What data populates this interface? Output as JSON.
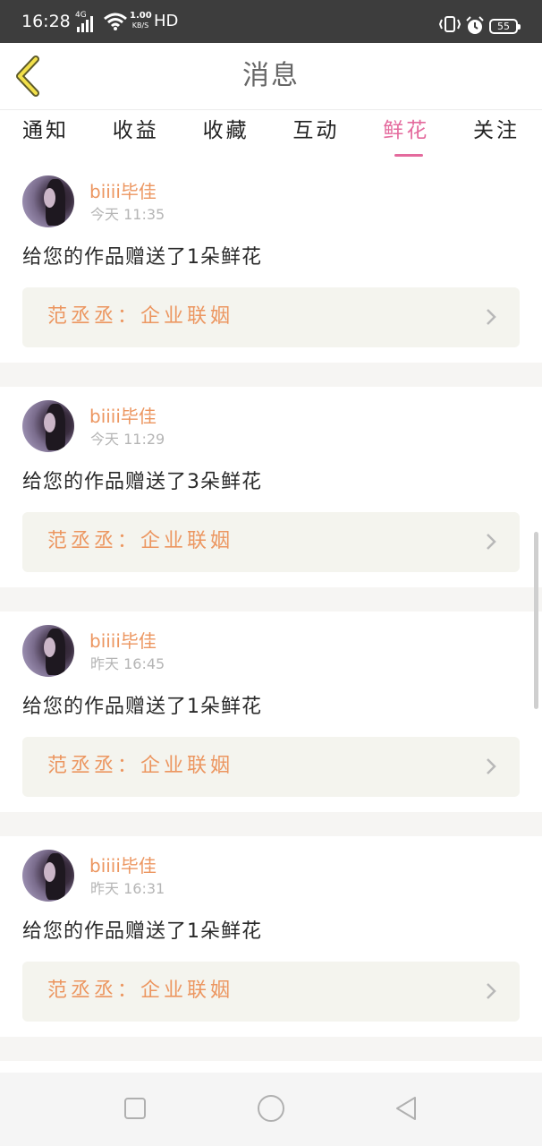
{
  "status_bar": {
    "time": "16:28",
    "network": "4G",
    "speed_value": "1.00",
    "speed_unit": "KB/S",
    "hd": "HD",
    "battery": "55"
  },
  "header": {
    "title": "消息",
    "back_icon": "chevron-left-icon"
  },
  "tabs": [
    {
      "label": "通知",
      "active": false
    },
    {
      "label": "收益",
      "active": false
    },
    {
      "label": "收藏",
      "active": false
    },
    {
      "label": "互动",
      "active": false
    },
    {
      "label": "鲜花",
      "active": true
    },
    {
      "label": "关注",
      "active": false
    }
  ],
  "messages": [
    {
      "user": "biiii毕佳",
      "time": "今天 11:35",
      "text": "给您的作品赠送了1朵鲜花",
      "work": "范丞丞：企业联姻"
    },
    {
      "user": "biiii毕佳",
      "time": "今天 11:29",
      "text": "给您的作品赠送了3朵鲜花",
      "work": "范丞丞：企业联姻"
    },
    {
      "user": "biiii毕佳",
      "time": "昨天 16:45",
      "text": "给您的作品赠送了1朵鲜花",
      "work": "范丞丞：企业联姻"
    },
    {
      "user": "biiii毕佳",
      "time": "昨天 16:31",
      "text": "给您的作品赠送了1朵鲜花",
      "work": "范丞丞：企业联姻"
    }
  ],
  "nav": {
    "recents_icon": "square-icon",
    "home_icon": "circle-icon",
    "back_icon": "triangle-back-icon"
  },
  "colors": {
    "accent": "#e46a9d",
    "username": "#ec9660",
    "status_bar": "#3d3d3d"
  }
}
